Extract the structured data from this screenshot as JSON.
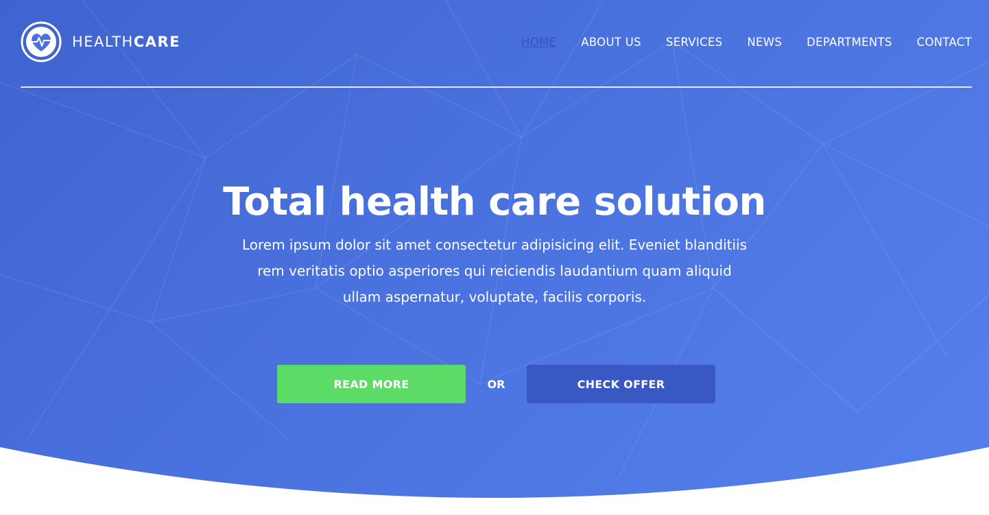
{
  "brand": {
    "name_light": "HEALTH",
    "name_bold": "CARE"
  },
  "nav": {
    "items": [
      {
        "label": "HOME",
        "active": true
      },
      {
        "label": "ABOUT US"
      },
      {
        "label": "SERVICES"
      },
      {
        "label": "NEWS"
      },
      {
        "label": "DEPARTMENTS"
      },
      {
        "label": "CONTACT"
      }
    ]
  },
  "hero": {
    "title": "Total health care solution",
    "subtitle": "Lorem ipsum dolor sit amet consectetur adipisicing elit. Eveniet blanditiis rem veritatis optio asperiores qui reiciendis laudantium quam aliquid ullam aspernatur, voluptate, facilis corporis.",
    "primary_button": "READ MORE",
    "separator": "OR",
    "secondary_button": "CHECK OFFER"
  },
  "colors": {
    "hero_gradient_start": "#3f63cf",
    "hero_gradient_end": "#5580ec",
    "primary_button": "#5cdb66",
    "secondary_button": "#3a58c4",
    "active_nav": "#3553b8"
  },
  "icons": {
    "logo": "heart-pulse-icon"
  }
}
